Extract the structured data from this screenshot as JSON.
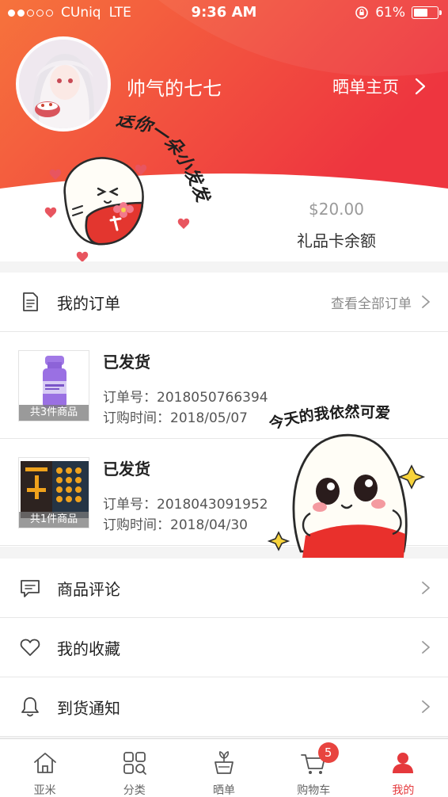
{
  "status_bar": {
    "carrier": "CUniq",
    "network": "LTE",
    "time": "9:36 AM",
    "battery": "61%",
    "battery_level": 0.61,
    "signal_bars": 2
  },
  "profile": {
    "username": "帅气的七七",
    "showcase_link": "晒单主页"
  },
  "sticker_text": {
    "gift": "送你一朵小发发",
    "cute": "今天的我依然可爱"
  },
  "gift_card": {
    "amount": "$20.00",
    "label": "礼品卡余额"
  },
  "orders": {
    "title": "我的订单",
    "view_all": "查看全部订单",
    "items": [
      {
        "status": "已发货",
        "order_no": "订单号：2018050766394",
        "date": "订购时间：2018/05/07",
        "count": "共3件商品"
      },
      {
        "status": "已发货",
        "order_no": "订单号：2018043091952",
        "date": "订购时间：2018/04/30",
        "count": "共1件商品"
      }
    ]
  },
  "menu": {
    "reviews": "商品评论",
    "favorites": "我的收藏",
    "notify": "到货通知"
  },
  "tabs": {
    "home": "亚米",
    "category": "分类",
    "showcase": "晒单",
    "cart": "购物车",
    "cart_badge": "5",
    "mine": "我的"
  },
  "colors": {
    "accent": "#e5393c",
    "header_start": "#f4743b",
    "header_end": "#ef3a3f"
  }
}
